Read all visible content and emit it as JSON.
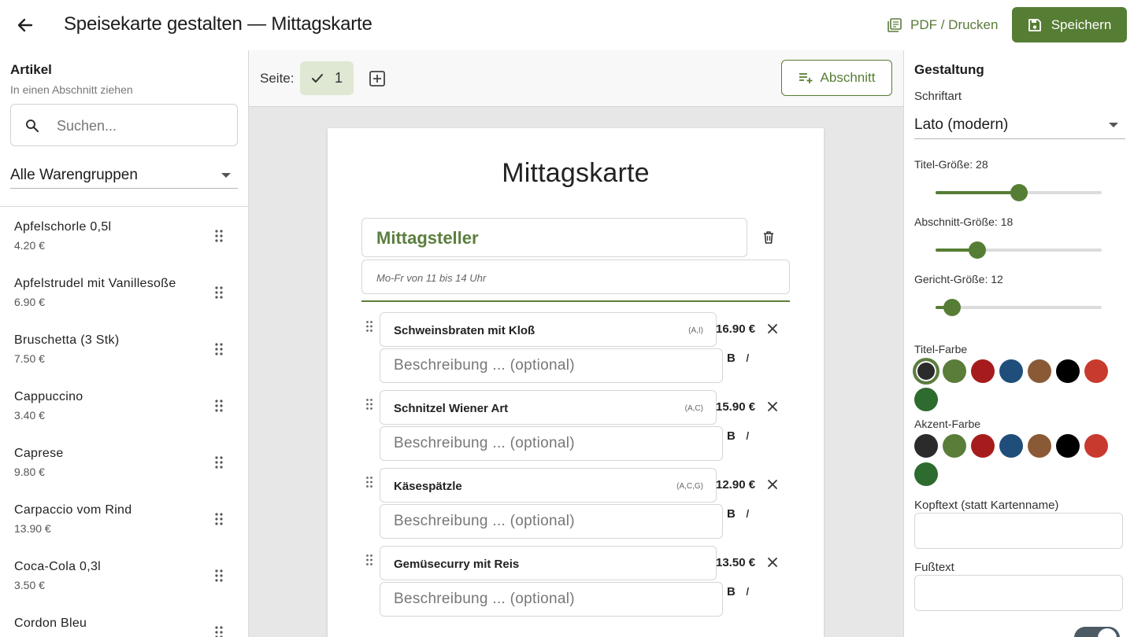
{
  "header": {
    "title": "Speisekarte gestalten — Mittagskarte",
    "pdf_label": "PDF / Drucken",
    "save_label": "Speichern"
  },
  "left": {
    "heading": "Artikel",
    "subheading": "In einen Abschnitt ziehen",
    "search_placeholder": "Suchen...",
    "group_select": "Alle Warengruppen",
    "items": [
      {
        "name": "Apfelschorle 0,5l",
        "price": "4.20 €"
      },
      {
        "name": "Apfelstrudel mit Vanillesoße",
        "price": "6.90 €"
      },
      {
        "name": "Bruschetta (3 Stk)",
        "price": "7.50 €"
      },
      {
        "name": "Cappuccino",
        "price": "3.40 €"
      },
      {
        "name": "Caprese",
        "price": "9.80 €"
      },
      {
        "name": "Carpaccio vom Rind",
        "price": "13.90 €"
      },
      {
        "name": "Coca-Cola 0,3l",
        "price": "3.50 €"
      },
      {
        "name": "Cordon Bleu",
        "price": ""
      }
    ]
  },
  "center": {
    "page_label": "Seite:",
    "page_number": "1",
    "section_button": "Abschnitt",
    "card_title": "Mittagskarte",
    "section": {
      "name": "Mittagsteller",
      "subtitle": "Mo-Fr von 11 bis 14 Uhr"
    },
    "desc_placeholder": "Beschreibung ... (optional)",
    "bold_label": "B",
    "italic_label": "I",
    "dishes": [
      {
        "name": "Schweinsbraten mit Kloß",
        "allergens": "(A,I)",
        "price": "16.90 €"
      },
      {
        "name": "Schnitzel Wiener Art",
        "allergens": "(A,C)",
        "price": "15.90 €"
      },
      {
        "name": "Käsespätzle",
        "allergens": "(A,C,G)",
        "price": "12.90 €"
      },
      {
        "name": "Gemüsecurry mit Reis",
        "allergens": "",
        "price": "13.50 €"
      }
    ]
  },
  "right": {
    "heading": "Gestaltung",
    "font_label": "Schriftart",
    "font_value": "Lato (modern)",
    "title_size_label": "Titel-Größe: 28",
    "title_size": 28,
    "section_size_label": "Abschnitt-Größe: 18",
    "section_size": 18,
    "dish_size_label": "Gericht-Größe: 12",
    "dish_size": 12,
    "title_color_label": "Titel-Farbe",
    "accent_color_label": "Akzent-Farbe",
    "colors": [
      "#2b2b2b",
      "#5a7d3a",
      "#a61c1c",
      "#1f4e7a",
      "#8a5a36",
      "#000000",
      "#c93a2e",
      "#2e6b2e"
    ],
    "title_color_selected": 0,
    "header_text_label": "Kopftext (statt Kartenname)",
    "footer_text_label": "Fußtext",
    "toggle_on": true
  }
}
